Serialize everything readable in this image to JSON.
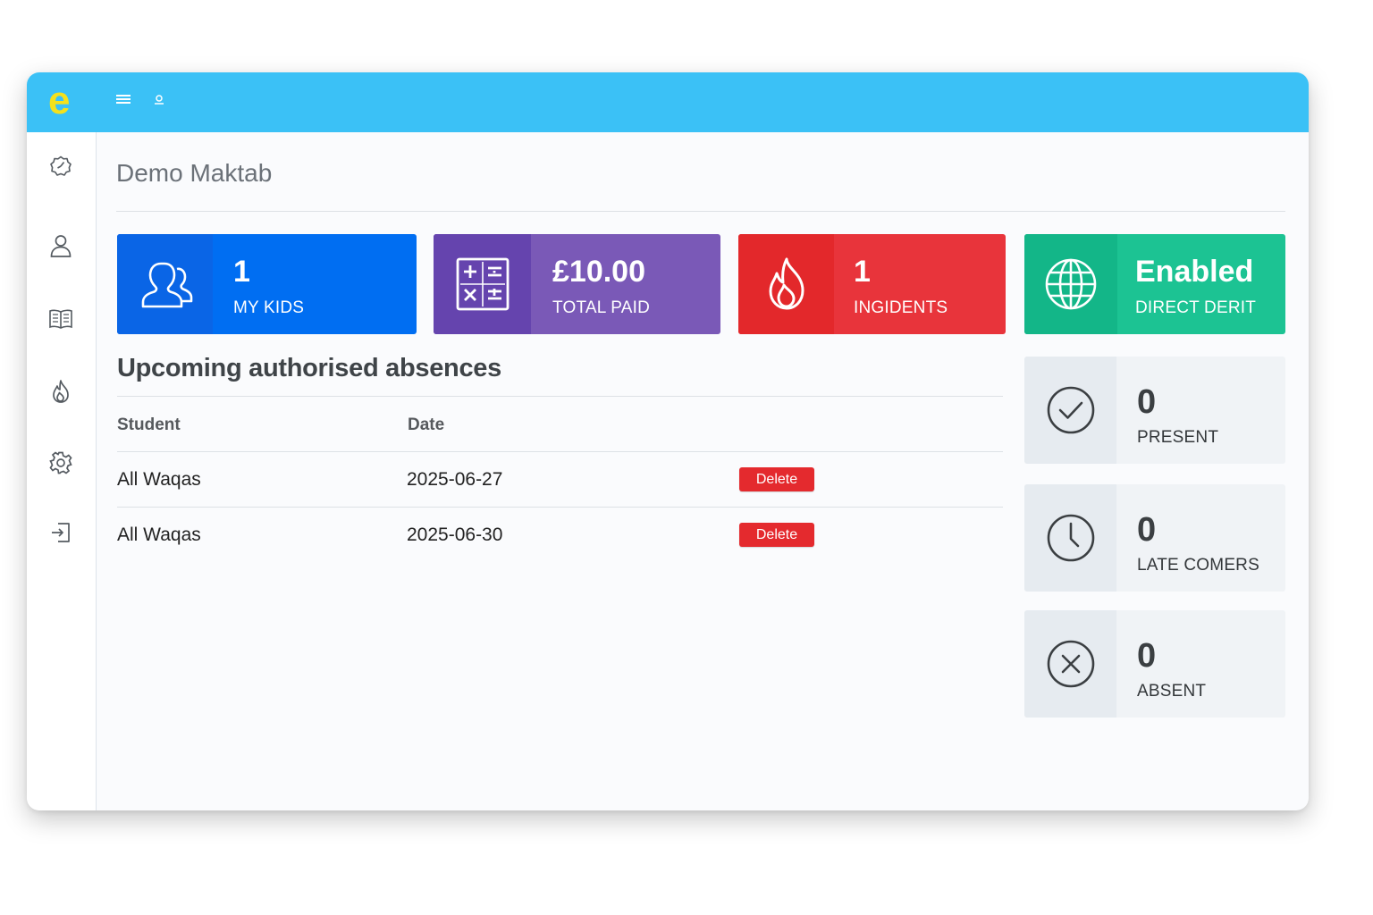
{
  "header": {
    "logo_text": "e",
    "brand_color": "#3bc1f6",
    "logo_color": "#f4e11c",
    "menu_icon": "hamburger-menu-icon",
    "user_icon": "user-icon"
  },
  "sidebar": {
    "items": [
      {
        "name": "dashboard",
        "icon": "dashboard-icon"
      },
      {
        "name": "profile",
        "icon": "user-icon"
      },
      {
        "name": "book",
        "icon": "book-icon"
      },
      {
        "name": "incidents",
        "icon": "fire-icon"
      },
      {
        "name": "settings",
        "icon": "gear-icon"
      },
      {
        "name": "logout",
        "icon": "logout-icon"
      }
    ]
  },
  "page": {
    "title": "Demo Maktab"
  },
  "stats": [
    {
      "value": "1",
      "label": "MY KIDS",
      "icon": "users-icon",
      "color": "#006ef2",
      "icon_bg": "#0a65e6"
    },
    {
      "value": "£10.00",
      "label": "TOTAL PAID",
      "icon": "calculator-icon",
      "color": "#7a59b7",
      "icon_bg": "#6544ae"
    },
    {
      "value": "1",
      "label": "INGIDENTS",
      "icon": "fire-icon",
      "color": "#e8343b",
      "icon_bg": "#e3282b"
    },
    {
      "value": "Enabled",
      "label": "DIRECT DERIT",
      "icon": "globe-icon",
      "color": "#1cc393",
      "icon_bg": "#13b688"
    }
  ],
  "absences": {
    "title": "Upcoming authorised absences",
    "columns": [
      "Student",
      "Date"
    ],
    "rows": [
      {
        "student": "All Waqas",
        "date": "2025-06-27",
        "action": "Delete"
      },
      {
        "student": "All Waqas",
        "date": "2025-06-30",
        "action": "Delete"
      }
    ]
  },
  "attendance": [
    {
      "value": "0",
      "label": "PRESENT",
      "icon": "check-circle-icon"
    },
    {
      "value": "0",
      "label": "LATE COMERS",
      "icon": "clock-icon"
    },
    {
      "value": "0",
      "label": "ABSENT",
      "icon": "x-circle-icon"
    }
  ]
}
